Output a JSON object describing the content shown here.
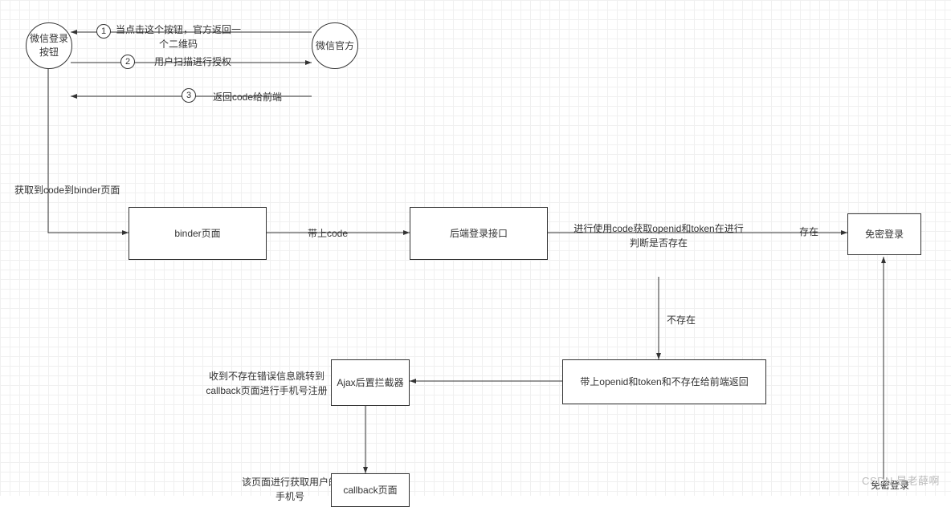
{
  "nodes": {
    "wechatLoginBtn": "微信登录按钮",
    "wechatOfficial": "微信官方",
    "binderPage": "binder页面",
    "backendLoginApi": "后端登录接口",
    "passwordlessLogin": "免密登录",
    "returnOpenidToken": "带上openid和token和不存在给前端返回",
    "ajaxInterceptor": "Ajax后置拦截器",
    "callbackPage": "callback页面"
  },
  "edges": {
    "step1": "当点击这个按钮，官方返回一个二维码",
    "step2": "用户扫描进行授权",
    "step3": "返回code给前端",
    "gotCodeToBinder": "获取到code到binder页面",
    "withCode": "带上code",
    "useCodeGetOpenid": "进行使用code获取openid和token在进行判断是否存在",
    "exists": "存在",
    "notExists": "不存在",
    "gotNotExistMsg": "收到不存在错误信息跳转到callback页面进行手机号注册",
    "pageGetUserPhone": "该页面进行获取用户的手机号",
    "passwordlessLoginBottom": "免密登录"
  },
  "stepNums": {
    "n1": "1",
    "n2": "2",
    "n3": "3"
  },
  "watermark": "CSDN   是老薛啊"
}
